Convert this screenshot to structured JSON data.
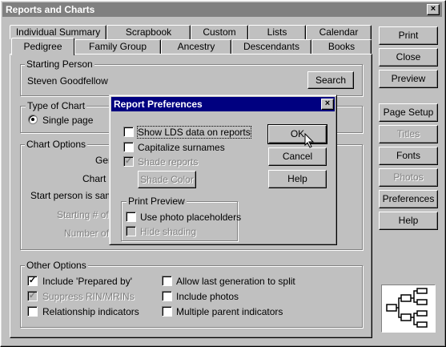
{
  "window": {
    "title": "Reports and Charts",
    "close": "×"
  },
  "tabs_back": [
    "Individual Summary",
    "Scrapbook",
    "Custom",
    "Lists",
    "Calendar"
  ],
  "tabs_front": [
    "Pedigree",
    "Family Group",
    "Ancestry",
    "Descendants",
    "Books"
  ],
  "starting_person": {
    "title": "Starting Person",
    "name": "Steven Goodfellow",
    "search": "Search"
  },
  "chart_type": {
    "title": "Type of Chart",
    "option": "Single page"
  },
  "chart_options": {
    "title": "Chart Options",
    "row1": "Ger",
    "row2": "Chart n",
    "row3": "Start person is same",
    "row4": "Starting # of c",
    "row5": "Number of c"
  },
  "other_options": {
    "title": "Other Options",
    "left": [
      {
        "label": "Include 'Prepared by'",
        "checked": true,
        "disabled": false
      },
      {
        "label": "Suppress RIN/MRINs",
        "checked": true,
        "disabled": true
      },
      {
        "label": "Relationship indicators",
        "checked": false,
        "disabled": false
      }
    ],
    "right": [
      {
        "label": "Allow last generation to split",
        "checked": false
      },
      {
        "label": "Include photos",
        "checked": false
      },
      {
        "label": "Multiple parent indicators",
        "checked": false
      }
    ]
  },
  "right_buttons": {
    "print": "Print",
    "close": "Close",
    "preview": "Preview",
    "page_setup": "Page Setup",
    "titles": "Titles",
    "fonts": "Fonts",
    "photos": "Photos",
    "preferences": "Preferences",
    "help": "Help"
  },
  "dialog": {
    "title": "Report Preferences",
    "close": "×",
    "show_lds": "Show LDS data on reports",
    "capitalize": "Capitalize surnames",
    "shade_reports": "Shade reports",
    "shade_color": "Shade Color",
    "print_preview_title": "Print Preview",
    "use_photo": "Use photo placeholders",
    "hide_shading": "Hide shading",
    "ok": "OK",
    "cancel": "Cancel",
    "help": "Help"
  }
}
